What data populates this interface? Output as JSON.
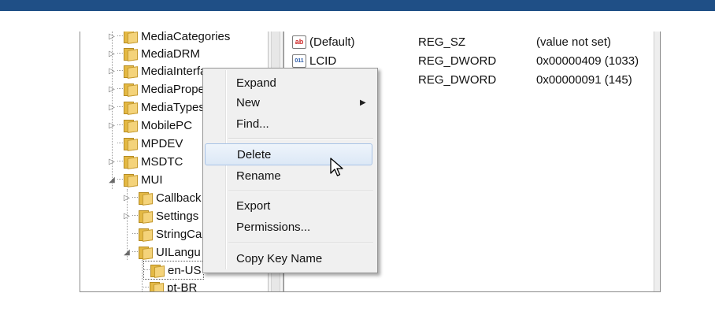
{
  "tree": {
    "items": [
      {
        "label": "MediaCategories",
        "expander": "▷"
      },
      {
        "label": "MediaDRM",
        "expander": "▷"
      },
      {
        "label": "MediaInterfaces",
        "expander": "▷"
      },
      {
        "label": "MediaProperties",
        "expander": "▷"
      },
      {
        "label": "MediaTypes",
        "expander": "▷"
      },
      {
        "label": "MobilePC",
        "expander": "▷"
      },
      {
        "label": "MPDEV",
        "expander": ""
      },
      {
        "label": "MSDTC",
        "expander": "▷"
      },
      {
        "label": "MUI",
        "expander": "◢"
      },
      {
        "label": "Callback",
        "expander": "▷"
      },
      {
        "label": "Settings",
        "expander": "▷"
      },
      {
        "label": "StringCa",
        "expander": ""
      },
      {
        "label": "UILangu",
        "expander": "◢"
      },
      {
        "label": "en-US",
        "expander": ""
      },
      {
        "label": "pt-BR",
        "expander": ""
      }
    ]
  },
  "values": {
    "rows": [
      {
        "icon": "ab",
        "name": "(Default)",
        "type": "REG_SZ",
        "data": "(value not set)"
      },
      {
        "icon": "011",
        "name": "LCID",
        "type": "REG_DWORD",
        "data": "0x00000409 (1033)"
      },
      {
        "icon": "011",
        "name": "",
        "type": "REG_DWORD",
        "data": "0x00000091 (145)"
      }
    ]
  },
  "context_menu": {
    "expand": "Expand",
    "new": "New",
    "new_arrow": "▶",
    "find": "Find...",
    "delete": "Delete",
    "rename": "Rename",
    "export": "Export",
    "permissions": "Permissions...",
    "copy_key_name": "Copy Key Name"
  },
  "colors": {
    "top_bar": "#1f4f86",
    "highlight_border": "#a9c3e6"
  }
}
